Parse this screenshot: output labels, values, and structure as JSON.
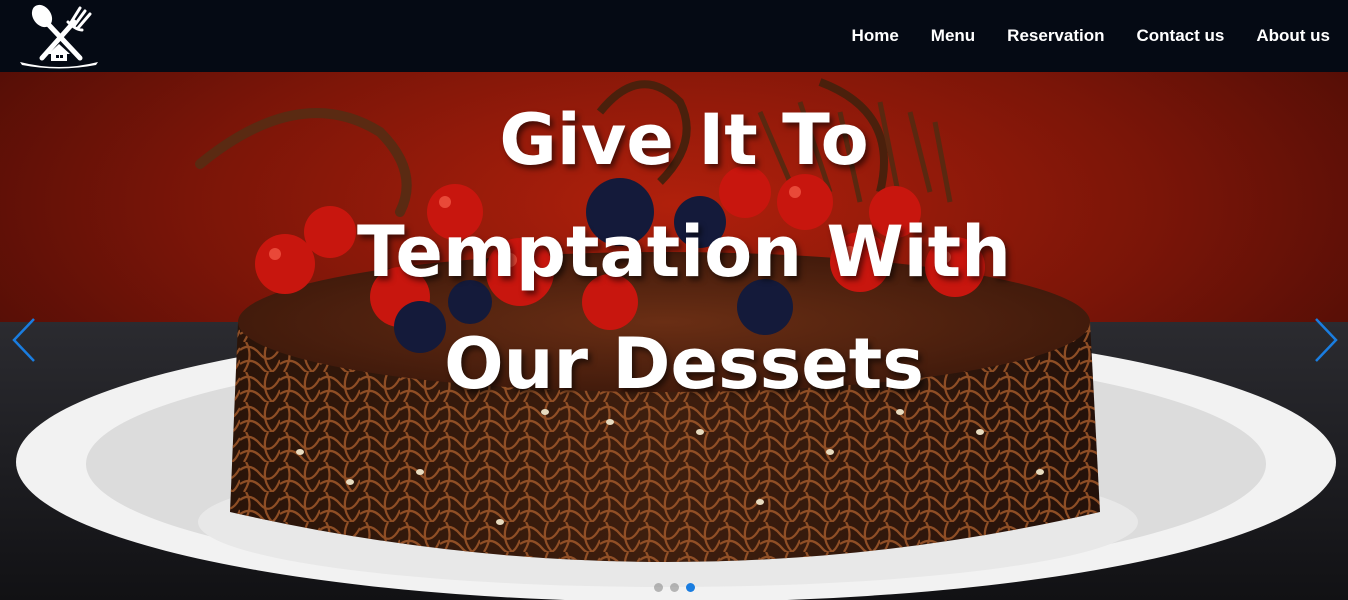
{
  "nav": {
    "logo_icon": "restaurant-house-fork-spoon-logo",
    "links": [
      {
        "label": "Home"
      },
      {
        "label": "Menu"
      },
      {
        "label": "Reservation"
      },
      {
        "label": "Contact us"
      },
      {
        "label": "About us"
      }
    ]
  },
  "hero": {
    "headline_lines": [
      "Give It To",
      "Temptation With",
      "Our Dessets"
    ],
    "image": "chocolate-cake-with-berries",
    "prev_icon": "chevron-left-icon",
    "next_icon": "chevron-right-icon",
    "slides_total": 3,
    "active_slide": 3
  },
  "colors": {
    "navbar_bg": "#050a14",
    "accent_arrow": "#1a7de0",
    "text": "#ffffff"
  }
}
